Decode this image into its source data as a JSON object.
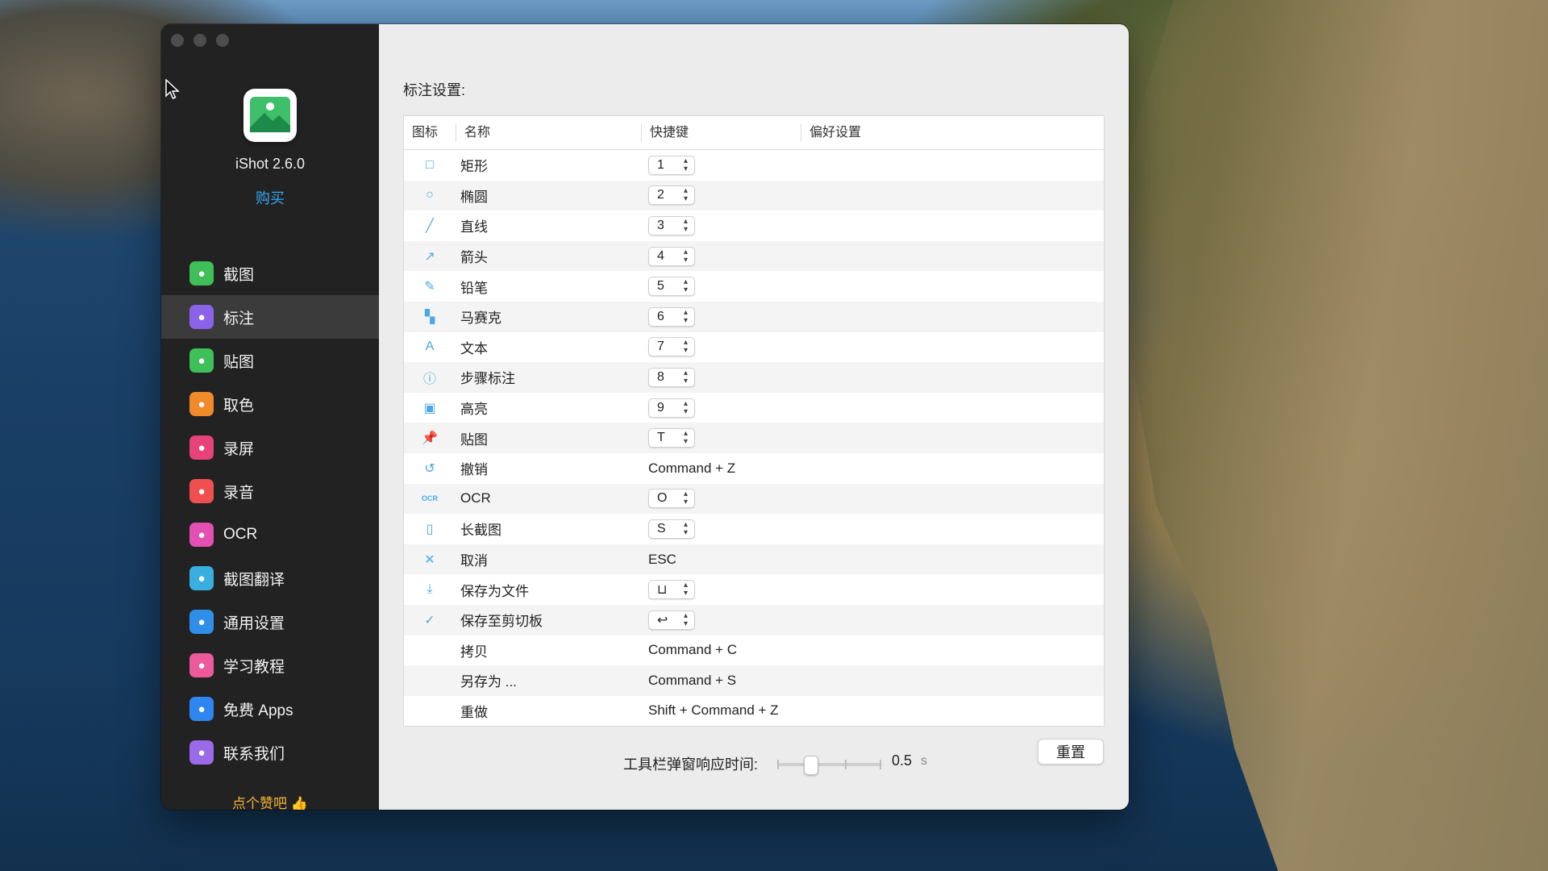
{
  "app": {
    "name": "iShot 2.6.0",
    "buy_label": "购买",
    "like_label": "点个赞吧 👍"
  },
  "sidebar": {
    "items": [
      {
        "label": "截图",
        "icon": "screenshot-icon",
        "color": "#3fbf57",
        "active": false
      },
      {
        "label": "标注",
        "icon": "cursor-icon",
        "color": "#8a63e8",
        "active": true
      },
      {
        "label": "贴图",
        "icon": "pin-icon",
        "color": "#3fbf57",
        "active": false
      },
      {
        "label": "取色",
        "icon": "eyedropper-icon",
        "color": "#f08a2a",
        "active": false
      },
      {
        "label": "录屏",
        "icon": "video-icon",
        "color": "#e8427a",
        "active": false
      },
      {
        "label": "录音",
        "icon": "microphone-icon",
        "color": "#ef4f4f",
        "active": false
      },
      {
        "label": "OCR",
        "icon": "ocr-icon",
        "color": "#e44fb4",
        "active": false
      },
      {
        "label": "截图翻译",
        "icon": "translate-icon",
        "color": "#3aaedf",
        "active": false
      },
      {
        "label": "通用设置",
        "icon": "gear-icon",
        "color": "#2f8ee8",
        "active": false
      },
      {
        "label": "学习教程",
        "icon": "tutorial-icon",
        "color": "#ec5a9b",
        "active": false
      },
      {
        "label": "免费 Apps",
        "icon": "appstore-icon",
        "color": "#2f86f0",
        "active": false
      },
      {
        "label": "联系我们",
        "icon": "contacts-icon",
        "color": "#9b6ae8",
        "active": false
      }
    ]
  },
  "main": {
    "section_title": "标注设置:",
    "columns": {
      "icon": "图标",
      "name": "名称",
      "shortcut": "快捷键",
      "pref": "偏好设置"
    },
    "rows": [
      {
        "icon": "rectangle-icon",
        "glyph": "□",
        "name": "矩形",
        "key": "1",
        "stepper": true
      },
      {
        "icon": "ellipse-icon",
        "glyph": "○",
        "name": "椭圆",
        "key": "2",
        "stepper": true
      },
      {
        "icon": "line-icon",
        "glyph": "╱",
        "name": "直线",
        "key": "3",
        "stepper": true
      },
      {
        "icon": "arrow-icon",
        "glyph": "↗",
        "name": "箭头",
        "key": "4",
        "stepper": true
      },
      {
        "icon": "pencil-icon",
        "glyph": "✎",
        "name": "铅笔",
        "key": "5",
        "stepper": true
      },
      {
        "icon": "mosaic-icon",
        "glyph": "▚",
        "name": "马赛克",
        "key": "6",
        "stepper": true
      },
      {
        "icon": "text-icon",
        "glyph": "A",
        "name": "文本",
        "key": "7",
        "stepper": true
      },
      {
        "icon": "step-icon",
        "glyph": "ⓘ",
        "name": "步骤标注",
        "key": "8",
        "stepper": true
      },
      {
        "icon": "highlight-icon",
        "glyph": "▣",
        "name": "高亮",
        "key": "9",
        "stepper": true
      },
      {
        "icon": "pin-icon",
        "glyph": "📌",
        "name": "贴图",
        "key": "T",
        "stepper": true
      },
      {
        "icon": "undo-icon",
        "glyph": "↺",
        "name": "撤销",
        "key": "Command + Z",
        "stepper": false
      },
      {
        "icon": "ocr-icon",
        "glyph": "OCR",
        "name": "OCR",
        "key": "O",
        "stepper": true
      },
      {
        "icon": "long-screenshot-icon",
        "glyph": "▯",
        "name": "长截图",
        "key": "S",
        "stepper": true
      },
      {
        "icon": "cancel-icon",
        "glyph": "✕",
        "name": "取消",
        "key": "ESC",
        "stepper": false
      },
      {
        "icon": "save-file-icon",
        "glyph": "⤓",
        "name": "保存为文件",
        "key": "⊔",
        "stepper": true
      },
      {
        "icon": "checkmark-icon",
        "glyph": "✓",
        "name": "保存至剪切板",
        "key": "↩",
        "stepper": true
      },
      {
        "icon": "",
        "glyph": "",
        "name": "拷贝",
        "key": "Command + C",
        "stepper": false
      },
      {
        "icon": "",
        "glyph": "",
        "name": "另存为 ...",
        "key": "Command + S",
        "stepper": false
      },
      {
        "icon": "",
        "glyph": "",
        "name": "重做",
        "key": "Shift + Command + Z",
        "stepper": false
      }
    ]
  },
  "footer": {
    "toolbar_delay_label": "工具栏弹窗响应时间:",
    "toolbar_delay_value": "0.5",
    "toolbar_delay_unit": "s",
    "reset_label": "重置"
  }
}
